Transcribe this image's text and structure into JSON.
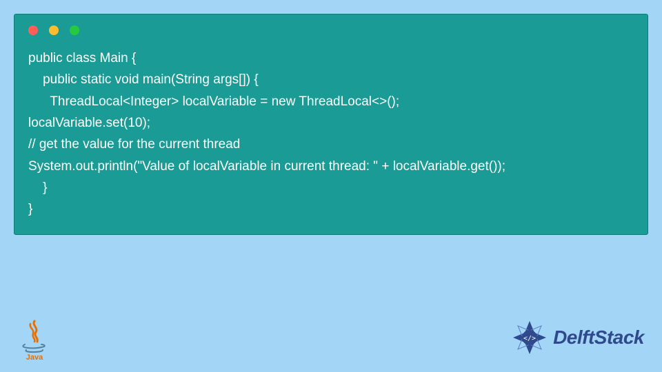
{
  "code": {
    "lines": [
      "public class Main {",
      "    public static void main(String args[]) {",
      "      ThreadLocal<Integer> localVariable = new ThreadLocal<>();",
      "localVariable.set(10);",
      "// get the value for the current thread",
      "System.out.println(\"Value of localVariable in current thread: \" + localVariable.get());",
      "    }",
      "}"
    ]
  },
  "branding": {
    "java_label": "Java",
    "delft_label": "DelftStack"
  },
  "colors": {
    "page_bg": "#a3d5f7",
    "window_bg": "#1a9b95",
    "code_text": "#ffffff",
    "dot_red": "#ff5f56",
    "dot_yellow": "#ffbd2e",
    "dot_green": "#27c93f",
    "delft_blue": "#2e4a8c"
  }
}
